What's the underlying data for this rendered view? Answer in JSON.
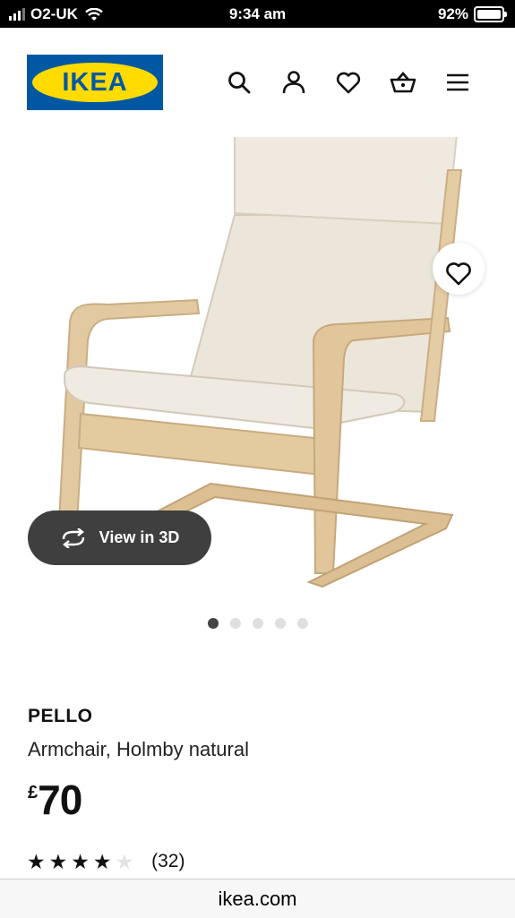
{
  "status_bar": {
    "carrier": "O2-UK",
    "time": "9:34 am",
    "battery": "92%"
  },
  "header": {
    "logo_text": "IKEA",
    "icons": [
      "search-icon",
      "account-icon",
      "favourites-icon",
      "basket-icon",
      "menu-icon"
    ]
  },
  "gallery": {
    "view_3d_label": "View in 3D",
    "image_count": 5,
    "active_index": 0
  },
  "product": {
    "name": "PELLO",
    "description": "Armchair, Holmby natural",
    "currency": "£",
    "price": "70",
    "rating": 4,
    "rating_max": 5,
    "review_count": "(32)"
  },
  "browser": {
    "url": "ikea.com"
  },
  "colors": {
    "ikea_blue": "#0058a3",
    "ikea_yellow": "#ffdb00",
    "pill_bg": "#3f3f3f"
  }
}
